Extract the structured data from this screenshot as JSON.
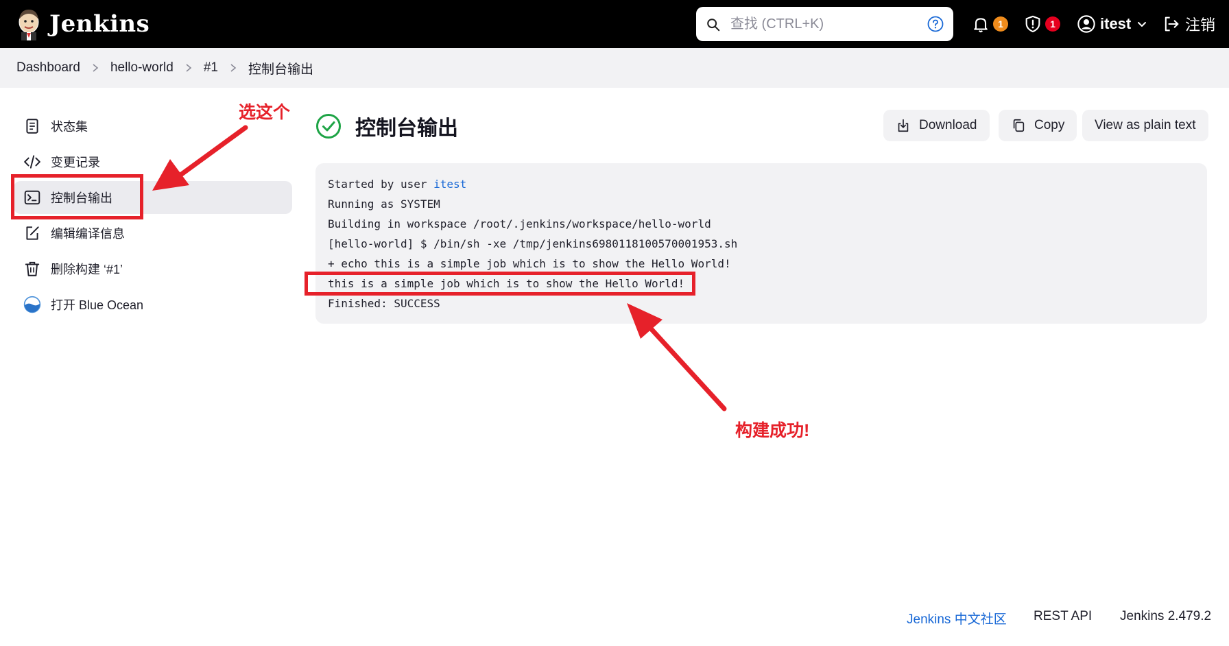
{
  "header": {
    "brand": "Jenkins",
    "search_placeholder": "查找 (CTRL+K)",
    "notifications_count": "1",
    "security_count": "1",
    "user": "itest",
    "logout": "注销"
  },
  "breadcrumb": [
    "Dashboard",
    "hello-world",
    "#1",
    "控制台输出"
  ],
  "sidebar": {
    "items": [
      {
        "label": "状态集",
        "icon": "document-icon"
      },
      {
        "label": "变更记录",
        "icon": "code-icon"
      },
      {
        "label": "控制台输出",
        "icon": "terminal-icon",
        "active": true
      },
      {
        "label": "编辑编译信息",
        "icon": "edit-icon"
      },
      {
        "label": "删除构建 ‘#1’",
        "icon": "trash-icon"
      },
      {
        "label": "打开 Blue Ocean",
        "icon": "blue-ocean-icon"
      }
    ]
  },
  "main": {
    "title": "控制台输出",
    "actions": {
      "download": "Download",
      "copy": "Copy",
      "plain": "View as plain text"
    },
    "console": {
      "line1_prefix": "Started by user ",
      "line1_user": "itest",
      "line2": "Running as SYSTEM",
      "line3": "Building in workspace /root/.jenkins/workspace/hello-world",
      "line4": "[hello-world] $ /bin/sh -xe /tmp/jenkins6980118100570001953.sh",
      "line5": "+ echo this is a simple job which is to show the Hello World!",
      "line6": "this is a simple job which is to show the Hello World!",
      "line7": "Finished: SUCCESS"
    }
  },
  "annotations": {
    "select_label": "选这个",
    "success_label": "构建成功!",
    "color": "#e6212a"
  },
  "footer": {
    "community": "Jenkins 中文社区",
    "rest_api": "REST API",
    "version": "Jenkins 2.479.2"
  },
  "colors": {
    "header_bg": "#000000",
    "link_blue": "#1868d6",
    "success_green": "#1ea446",
    "badge_orange": "#f08c1c",
    "badge_red": "#e6001f"
  }
}
